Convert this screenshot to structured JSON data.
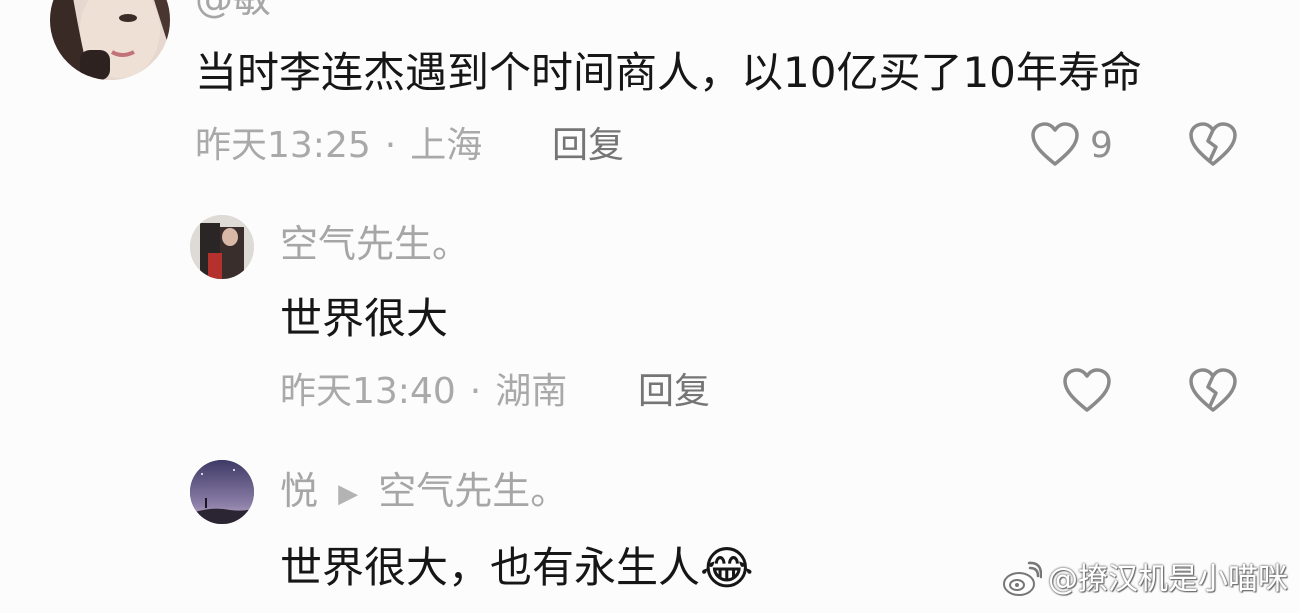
{
  "comments": [
    {
      "username": "@敏",
      "text": "当时李连杰遇到个时间商人，以10亿买了10年寿命",
      "time": "昨天13:25",
      "separator": "·",
      "location": "上海",
      "reply_label": "回复",
      "like_count": "9"
    },
    {
      "username": "空气先生。",
      "text": "世界很大",
      "time": "昨天13:40",
      "separator": "·",
      "location": "湖南",
      "reply_label": "回复",
      "like_count": ""
    },
    {
      "username": "悦",
      "reply_to_arrow": "▶",
      "reply_to": "空气先生。",
      "text": "世界很大，也有永生人",
      "emoji": "😂"
    }
  ],
  "watermark": {
    "text": "@撩汉机是小喵咪"
  },
  "colors": {
    "background": "#fcfcfc",
    "text": "#161616",
    "muted": "#a9a9a9",
    "icon": "#8a8a8a"
  }
}
